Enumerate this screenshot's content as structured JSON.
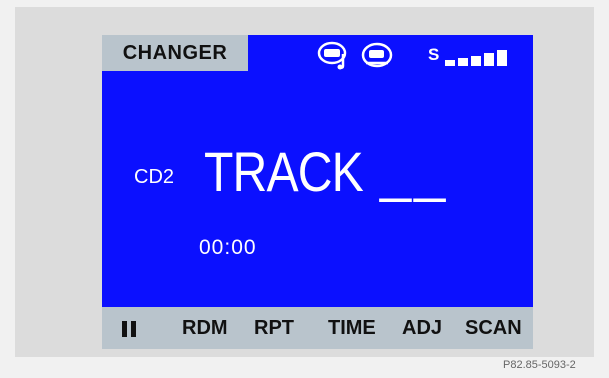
{
  "display": {
    "mode_label": "CHANGER",
    "source": "CD2",
    "track_label": "TRACK",
    "track_number": "__",
    "time": "00:00",
    "status_icons": [
      "tape-icon",
      "cd-icon"
    ],
    "signal": {
      "label": "S",
      "bars_shown": 5
    }
  },
  "softkeys": [
    {
      "id": "pause",
      "label": "",
      "icon": "pause-icon"
    },
    {
      "id": "rdm",
      "label": "RDM"
    },
    {
      "id": "rpt",
      "label": "RPT"
    },
    {
      "id": "time",
      "label": "TIME"
    },
    {
      "id": "adj",
      "label": "ADJ"
    },
    {
      "id": "scan",
      "label": "SCAN"
    }
  ],
  "caption": "P82.85-5093-2",
  "colors": {
    "screen_blue": "#0b10ff",
    "tab_gray": "#b9c4cc",
    "text_dark": "#111111",
    "text_light": "#ffffff"
  }
}
